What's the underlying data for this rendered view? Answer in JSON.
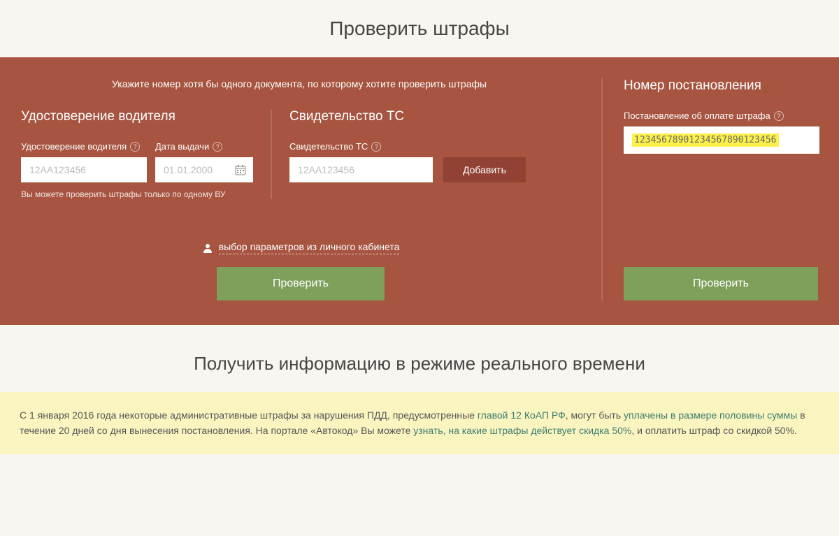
{
  "page": {
    "title": "Проверить штрафы"
  },
  "main": {
    "intro": "Укажите номер хотя бы одного документа, по которому хотите проверить штрафы",
    "license": {
      "title": "Удостоверение водителя",
      "license_label": "Удостоверение водителя",
      "license_placeholder": "12АА123456",
      "date_label": "Дата выдачи",
      "date_placeholder": "01.01.2000",
      "hint": "Вы можете проверить штрафы только по одному ВУ"
    },
    "certificate": {
      "title": "Свидетельство ТС",
      "cert_label": "Свидетельство ТС",
      "cert_placeholder": "12АА123456",
      "add_button": "Добавить"
    },
    "resolution": {
      "title": "Номер постановления",
      "label": "Постановление об оплате штрафа",
      "value": "12345678901234567890123456"
    },
    "personal_cabinet": "выбор параметров из личного кабинета",
    "check_button": "Проверить"
  },
  "realtime": {
    "title": "Получить информацию в режиме реального времени",
    "notice_part1": "С 1 января 2016 года некоторые административные штрафы за нарушения ПДД, предусмотренные ",
    "notice_link1": "главой 12 КоАП РФ",
    "notice_part2": ", могут быть ",
    "notice_link2": "уплачены в размере половины суммы",
    "notice_part3": " в течение 20 дней со дня вынесения постановления. На портале «Автокод» Вы можете ",
    "notice_link3": "узнать, на какие штрафы действует скидка 50%",
    "notice_part4": ", и оплатить штраф со скидкой 50%."
  }
}
